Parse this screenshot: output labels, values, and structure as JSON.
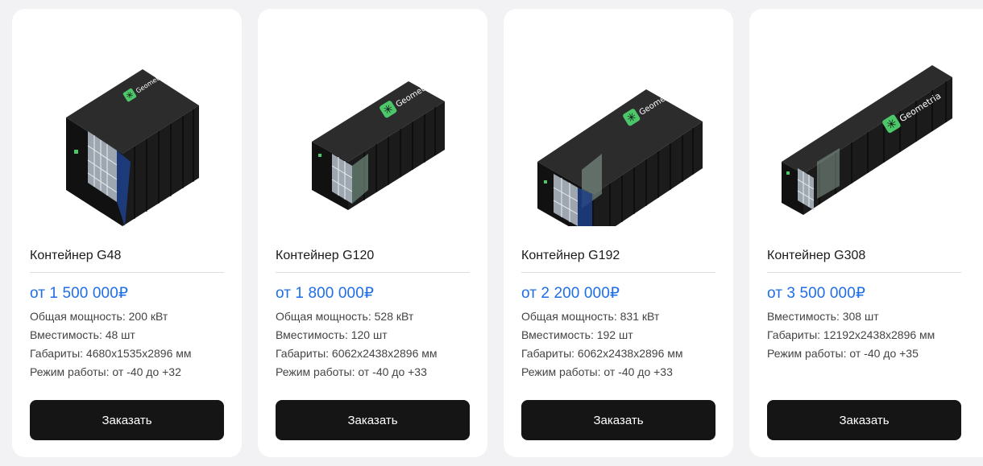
{
  "products": [
    {
      "brand": "Geometria",
      "title": "Контейнер G48",
      "price": "от 1 500 000₽",
      "specs": [
        "Общая мощность: 200 кВт",
        "Вместимость: 48 шт",
        "Габариты: 4680x1535x2896 мм",
        "Режим работы: от -40 до +32"
      ],
      "button": "Заказать"
    },
    {
      "brand": "Geometria",
      "title": "Контейнер G120",
      "price": "от 1 800 000₽",
      "specs": [
        "Общая мощность: 528 кВт",
        "Вместимость: 120 шт",
        "Габариты: 6062x2438x2896 мм",
        "Режим работы: от -40 до +33"
      ],
      "button": "Заказать"
    },
    {
      "brand": "Geometria",
      "title": "Контейнер G192",
      "price": "от 2 200 000₽",
      "specs": [
        "Общая мощность: 831 кВт",
        "Вместимость: 192 шт",
        "Габариты: 6062x2438x2896 мм",
        "Режим работы: от -40 до +33"
      ],
      "button": "Заказать"
    },
    {
      "brand": "Geometria",
      "title": "Контейнер G308",
      "price": "от 3 500 000₽",
      "specs": [
        "Вместимость: 308 шт",
        "Габариты: 12192x2438x2896 мм",
        "Режим работы: от -40 до +35"
      ],
      "button": "Заказать"
    }
  ],
  "colors": {
    "price": "#1f6ee8",
    "button_bg": "#151515",
    "brand_badge": "#4cc86a"
  }
}
